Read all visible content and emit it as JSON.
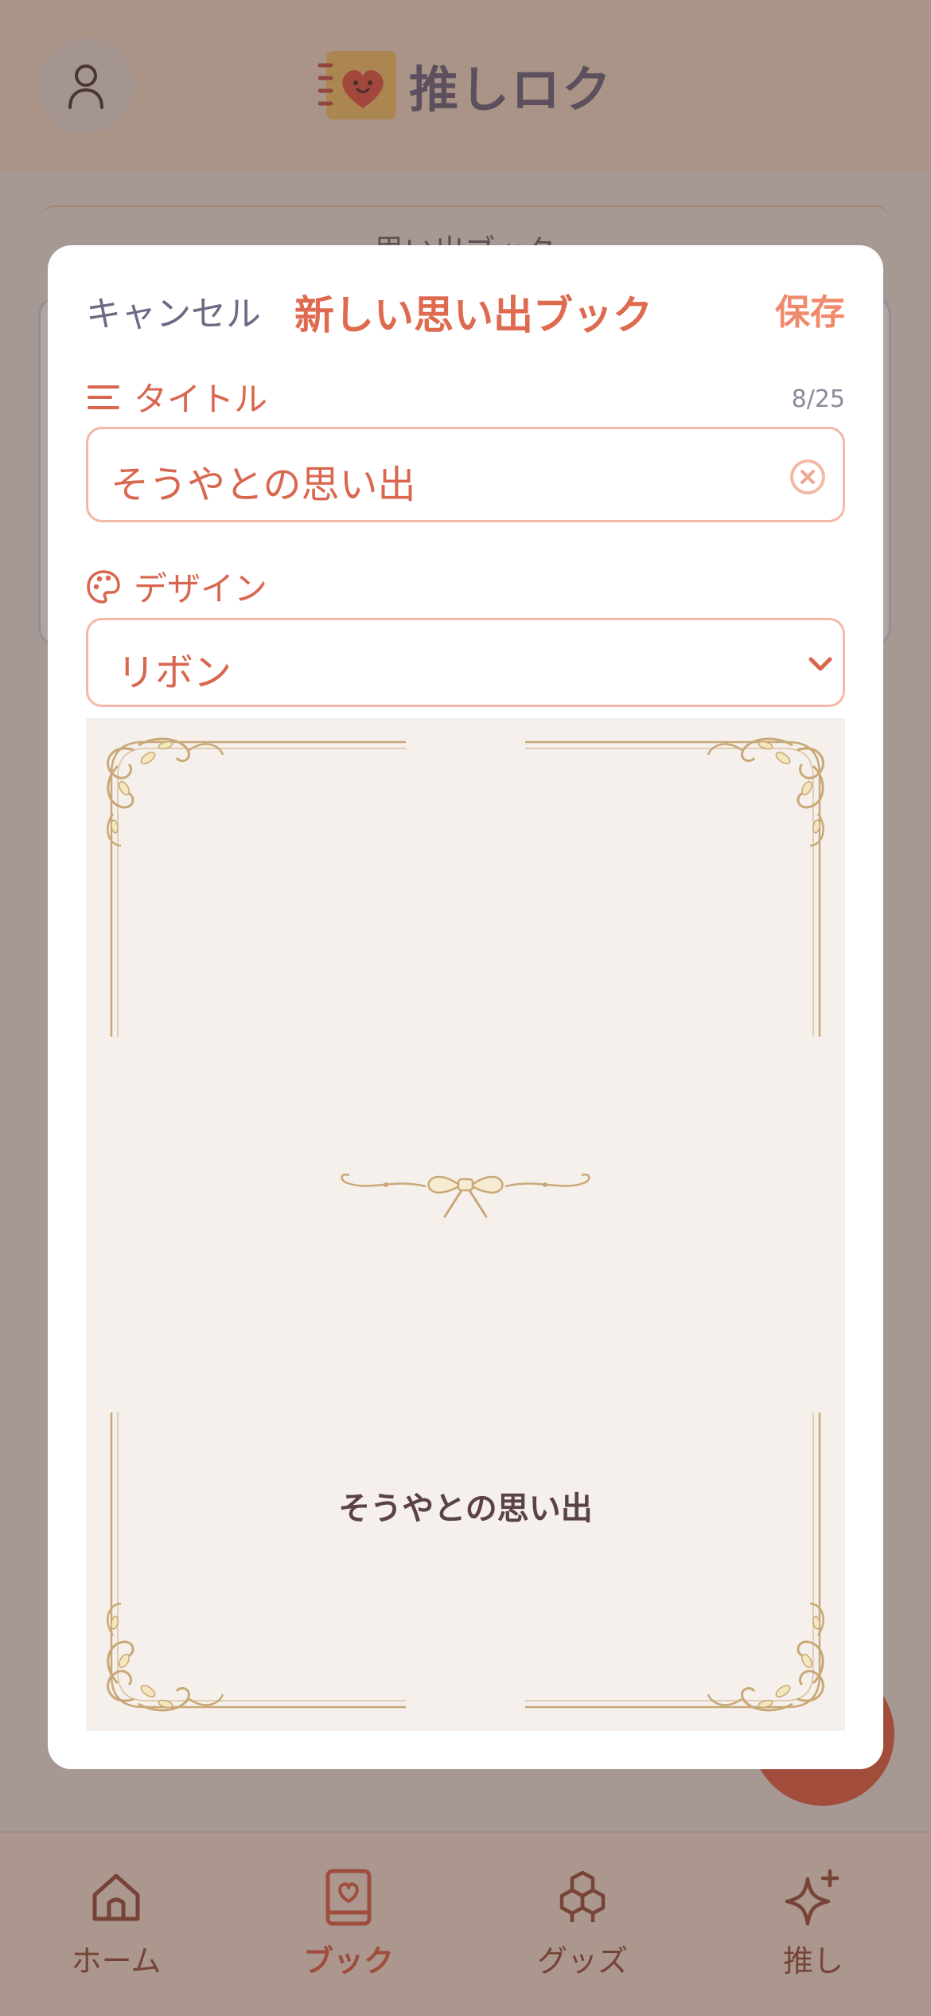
{
  "app": {
    "name": "推しロク"
  },
  "background": {
    "section_tab": "思い出ブック"
  },
  "modal": {
    "cancel_label": "キャンセル",
    "title": "新しい思い出ブック",
    "save_label": "保存",
    "title_field": {
      "label": "タイトル",
      "value": "そうやとの思い出",
      "count": "8/25"
    },
    "design_field": {
      "label": "デザイン",
      "selected": "リボン"
    },
    "preview": {
      "title": "そうやとの思い出"
    }
  },
  "bottom_nav": {
    "items": [
      {
        "label": "ホーム",
        "icon": "home-icon",
        "active": false
      },
      {
        "label": "ブック",
        "icon": "book-icon",
        "active": true
      },
      {
        "label": "グッズ",
        "icon": "cubes-icon",
        "active": false
      },
      {
        "label": "推し",
        "icon": "sparkle-icon",
        "active": false
      }
    ]
  },
  "colors": {
    "accent": "#de6a50",
    "accent_light": "#f3b9a5",
    "muted_text": "#6e6a85",
    "ornament": "#c9a877"
  }
}
